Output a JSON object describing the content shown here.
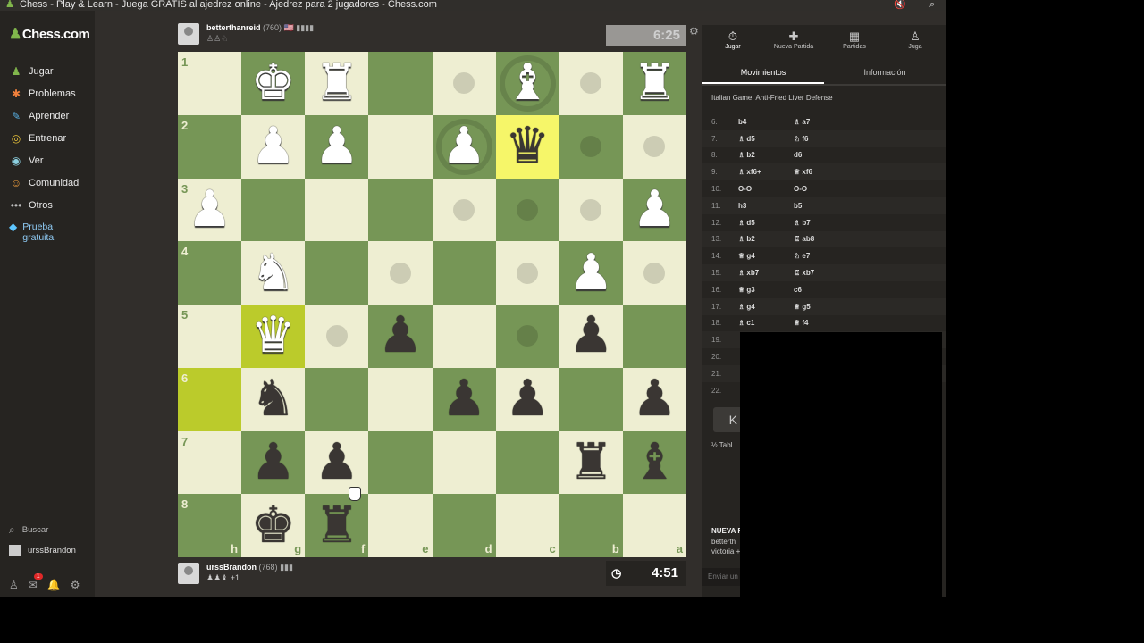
{
  "window": {
    "title": "Chess - Play & Learn - Juega GRATIS al ajedrez online - Ajedrez para 2 jugadores - Chess.com",
    "app_icon": "pawn-icon",
    "mute_icon": "speaker-muted-icon",
    "zoom_icon": "magnifier-icon"
  },
  "sidebar": {
    "logo_text": "Chess.com",
    "items": [
      {
        "label": "Jugar",
        "icon": "play-icon",
        "glyph": "♟"
      },
      {
        "label": "Problemas",
        "icon": "puzzle-icon",
        "glyph": "✱"
      },
      {
        "label": "Aprender",
        "icon": "learn-icon",
        "glyph": "✎"
      },
      {
        "label": "Entrenar",
        "icon": "train-icon",
        "glyph": "◎"
      },
      {
        "label": "Ver",
        "icon": "watch-icon",
        "glyph": "◉"
      },
      {
        "label": "Comunidad",
        "icon": "community-icon",
        "glyph": "☺"
      },
      {
        "label": "Otros",
        "icon": "more-icon",
        "glyph": "•••"
      }
    ],
    "trial_line1": "Prueba",
    "trial_line2": "gratuita",
    "search_label": "Buscar",
    "user_label": "urssBrandon",
    "notification_count": "1"
  },
  "opponent": {
    "name": "betterthanreid",
    "rating": "(760)",
    "clock": "6:25",
    "flag_bars": "🇺🇸 ▮▮▮▮"
  },
  "player": {
    "name": "urssBrandon",
    "rating": "(768)",
    "captured": "♟♟♝ +1",
    "clock": "4:51",
    "flag_bars": "▮▮▮"
  },
  "board": {
    "ranks": [
      "1",
      "2",
      "3",
      "4",
      "5",
      "6",
      "7",
      "8"
    ],
    "files": [
      "h",
      "g",
      "f",
      "e",
      "d",
      "c",
      "b",
      "a"
    ],
    "pieces": [
      {
        "row": 0,
        "col": 1,
        "glyph": "♚",
        "color": "white"
      },
      {
        "row": 0,
        "col": 2,
        "glyph": "♜",
        "color": "white"
      },
      {
        "row": 0,
        "col": 5,
        "glyph": "♝",
        "color": "white"
      },
      {
        "row": 0,
        "col": 7,
        "glyph": "♜",
        "color": "white"
      },
      {
        "row": 1,
        "col": 1,
        "glyph": "♟",
        "color": "white"
      },
      {
        "row": 1,
        "col": 2,
        "glyph": "♟",
        "color": "white"
      },
      {
        "row": 1,
        "col": 4,
        "glyph": "♟",
        "color": "white"
      },
      {
        "row": 1,
        "col": 5,
        "glyph": "♛",
        "color": "black"
      },
      {
        "row": 2,
        "col": 0,
        "glyph": "♟",
        "color": "white"
      },
      {
        "row": 2,
        "col": 7,
        "glyph": "♟",
        "color": "white"
      },
      {
        "row": 3,
        "col": 1,
        "glyph": "♞",
        "color": "white"
      },
      {
        "row": 3,
        "col": 6,
        "glyph": "♟",
        "color": "white"
      },
      {
        "row": 4,
        "col": 1,
        "glyph": "♛",
        "color": "white"
      },
      {
        "row": 4,
        "col": 3,
        "glyph": "♟",
        "color": "black"
      },
      {
        "row": 4,
        "col": 6,
        "glyph": "♟",
        "color": "black"
      },
      {
        "row": 5,
        "col": 1,
        "glyph": "♞",
        "color": "black"
      },
      {
        "row": 5,
        "col": 4,
        "glyph": "♟",
        "color": "black"
      },
      {
        "row": 5,
        "col": 5,
        "glyph": "♟",
        "color": "black"
      },
      {
        "row": 5,
        "col": 7,
        "glyph": "♟",
        "color": "black"
      },
      {
        "row": 6,
        "col": 1,
        "glyph": "♟",
        "color": "black"
      },
      {
        "row": 6,
        "col": 2,
        "glyph": "♟",
        "color": "black"
      },
      {
        "row": 6,
        "col": 6,
        "glyph": "♜",
        "color": "black"
      },
      {
        "row": 6,
        "col": 7,
        "glyph": "♝",
        "color": "black"
      },
      {
        "row": 7,
        "col": 1,
        "glyph": "♚",
        "color": "black"
      },
      {
        "row": 7,
        "col": 2,
        "glyph": "♜",
        "color": "black"
      }
    ],
    "highlights": [
      {
        "row": 1,
        "col": 5
      },
      {
        "row": 4,
        "col": 1
      },
      {
        "row": 5,
        "col": 0
      }
    ],
    "move_dots": [
      {
        "row": 0,
        "col": 4
      },
      {
        "row": 0,
        "col": 6
      },
      {
        "row": 1,
        "col": 6
      },
      {
        "row": 1,
        "col": 7
      },
      {
        "row": 2,
        "col": 4
      },
      {
        "row": 2,
        "col": 5
      },
      {
        "row": 2,
        "col": 6
      },
      {
        "row": 3,
        "col": 3
      },
      {
        "row": 3,
        "col": 5
      },
      {
        "row": 3,
        "col": 7
      },
      {
        "row": 4,
        "col": 2
      },
      {
        "row": 4,
        "col": 5
      }
    ],
    "capture_rings": [
      {
        "row": 0,
        "col": 5
      },
      {
        "row": 1,
        "col": 4
      }
    ],
    "colors": {
      "light": "#eeeed2",
      "dark": "#769656",
      "highlight_light": "#f6f669",
      "highlight_dark": "#bbcb2b"
    }
  },
  "panel": {
    "tabs": [
      {
        "label": "Jugar",
        "icon": "clock-icon",
        "glyph": "⏱"
      },
      {
        "label": "Nueva Partida",
        "icon": "plus-icon",
        "glyph": "✚"
      },
      {
        "label": "Partidas",
        "icon": "board-icon",
        "glyph": "▦"
      },
      {
        "label": "Juga",
        "icon": "players-icon",
        "glyph": "♙"
      }
    ],
    "subtabs": [
      "Movimientos",
      "Información"
    ],
    "opening": "Italian Game: Anti-Fried Liver Defense",
    "moves": [
      {
        "num": "6.",
        "white": "b4",
        "black": "♗ a7"
      },
      {
        "num": "7.",
        "white": "♗ d5",
        "black": "♘ f6"
      },
      {
        "num": "8.",
        "white": "♗ b2",
        "black": "d6"
      },
      {
        "num": "9.",
        "white": "♗ xf6+",
        "black": "♕ xf6"
      },
      {
        "num": "10.",
        "white": "O-O",
        "black": "O-O"
      },
      {
        "num": "11.",
        "white": "h3",
        "black": "b5"
      },
      {
        "num": "12.",
        "white": "♗ d5",
        "black": "♗ b7"
      },
      {
        "num": "13.",
        "white": "♗ b2",
        "black": "♖ ab8"
      },
      {
        "num": "14.",
        "white": "♕ g4",
        "black": "♘ e7"
      },
      {
        "num": "15.",
        "white": "♗ xb7",
        "black": "♖ xb7"
      },
      {
        "num": "16.",
        "white": "♕ g3",
        "black": "c6"
      },
      {
        "num": "17.",
        "white": "♗ g4",
        "black": "♕ g5"
      },
      {
        "num": "18.",
        "white": "♗ c1",
        "black": "♕ f4"
      },
      {
        "num": "19.",
        "white": "",
        "black": ""
      },
      {
        "num": "20.",
        "white": "",
        "black": ""
      },
      {
        "num": "21.",
        "white": "",
        "black": ""
      },
      {
        "num": "22.",
        "white": "",
        "black": ""
      }
    ],
    "nav_glyph": "K",
    "half_text": "½ Tabl",
    "new_title": "NUEVA P",
    "new_line1": "betterth",
    "new_line2": "victoria +",
    "chat_placeholder": "Enviar un"
  }
}
